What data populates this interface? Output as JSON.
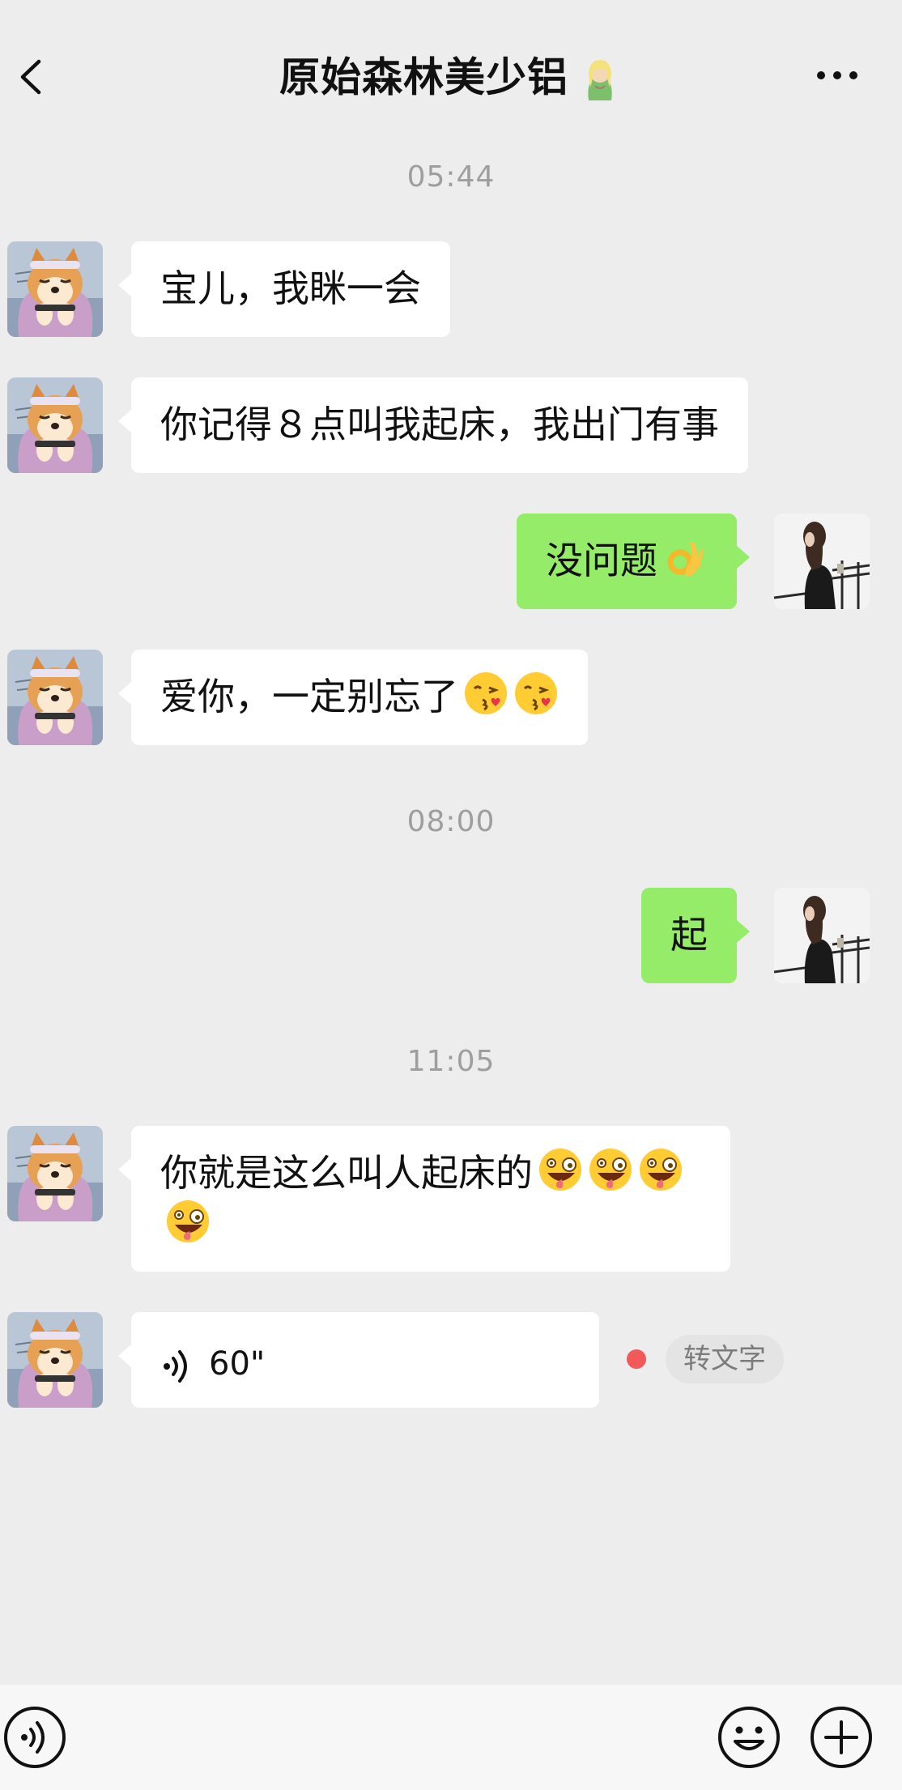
{
  "header": {
    "title": "原始森林美少铝",
    "back_icon": "chevron-left-icon",
    "more_icon": "more-dots-icon",
    "title_emoji": "genie-emoji"
  },
  "messages": [
    {
      "type": "time",
      "text": "05:44"
    },
    {
      "type": "text",
      "side": "left",
      "text": "宝儿，我眯一会"
    },
    {
      "type": "text",
      "side": "left",
      "text": "你记得８点叫我起床，我出门有事"
    },
    {
      "type": "text",
      "side": "right",
      "text": "没问题",
      "emoji": "ok-hand-emoji"
    },
    {
      "type": "text",
      "side": "left",
      "text": "爱你，一定别忘了",
      "emoji": "kissing-face-emoji"
    },
    {
      "type": "time",
      "text": "08:00"
    },
    {
      "type": "text",
      "side": "right",
      "text": "起"
    },
    {
      "type": "time",
      "text": "11:05"
    },
    {
      "type": "text",
      "side": "left",
      "text": "你就是这么叫人起床的",
      "emoji": "zany-face-emoji"
    },
    {
      "type": "voice",
      "side": "left",
      "duration": "60\"",
      "to_text": "转文字",
      "unread": true
    }
  ],
  "bottom_bar": {
    "voice_icon": "voice-input-icon",
    "emoji_icon": "emoji-icon",
    "plus_icon": "plus-icon"
  },
  "colors": {
    "background": "#ededed",
    "bubble_self": "#95ec69",
    "bubble_other": "#ffffff",
    "unread_dot": "#f25a5a"
  }
}
